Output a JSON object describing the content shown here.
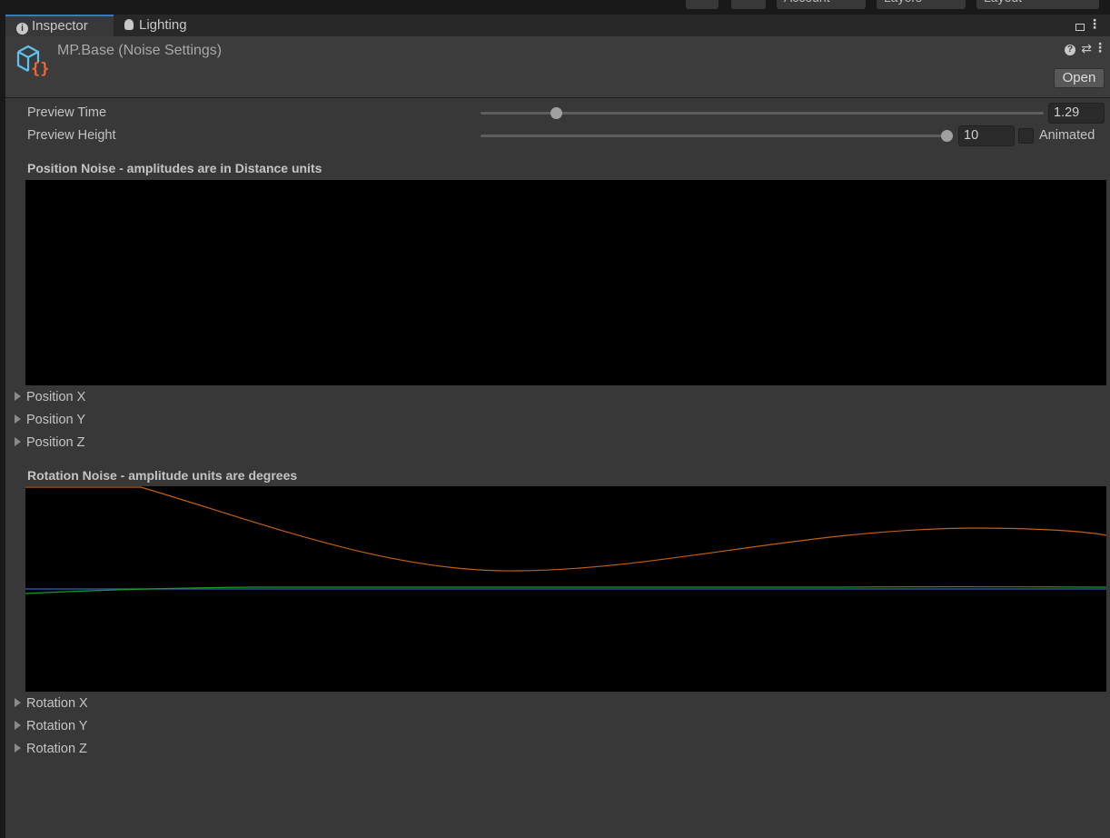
{
  "toolbar": {
    "account": "Account",
    "layers": "Layers",
    "layout": "Layout"
  },
  "tabs": [
    {
      "label": "Inspector",
      "icon": "info-icon"
    },
    {
      "label": "Lighting",
      "icon": "lightbulb-icon"
    }
  ],
  "header": {
    "title": "MP.Base (Noise Settings)",
    "open_label": "Open"
  },
  "preview_time": {
    "label": "Preview Time",
    "value": "1.29",
    "fraction": 0.13
  },
  "preview_height": {
    "label": "Preview Height",
    "value": "10",
    "fraction": 1.0,
    "animated_label": "Animated",
    "animated": false
  },
  "position_noise": {
    "title": "Position Noise - amplitudes are in Distance units",
    "items": [
      "Position X",
      "Position Y",
      "Position Z"
    ]
  },
  "rotation_noise": {
    "title": "Rotation Noise - amplitude units are degrees",
    "items": [
      "Rotation X",
      "Rotation Y",
      "Rotation Z"
    ],
    "colors": {
      "x": "#c2600f",
      "y": "#1a9c1a",
      "z": "#2a4fa0"
    }
  }
}
